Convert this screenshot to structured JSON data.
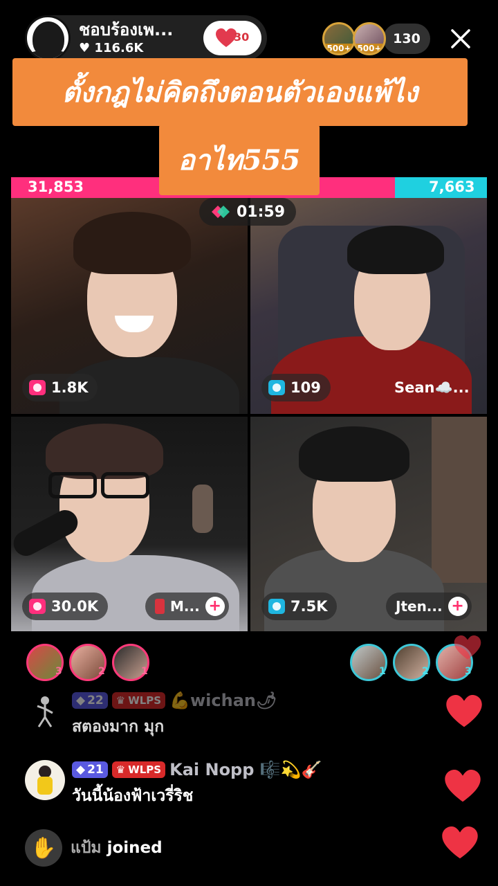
{
  "host": {
    "name": "ชอบร้องเพ...",
    "likes": "116.6K",
    "fan_level": "30"
  },
  "top_viewers": [
    {
      "badge": "500+"
    },
    {
      "badge": "500+"
    }
  ],
  "viewer_count": "130",
  "caption": {
    "line1": "ตั้งกฎไม่คิดถึงตอนตัวเองแพ้ไง",
    "line2": "อาไท555"
  },
  "battle": {
    "left_score": "31,853",
    "right_score": "7,663",
    "left_fraction": 0.806,
    "timer": "01:59"
  },
  "tiles": [
    {
      "score": "1.8K",
      "team": "pink",
      "name": ""
    },
    {
      "score": "109",
      "team": "blue",
      "name": "Sean☁️..."
    },
    {
      "score": "30.0K",
      "team": "pink",
      "name": "M..."
    },
    {
      "score": "7.5K",
      "team": "blue",
      "name": "Jten..."
    }
  ],
  "supporters_left": [
    {
      "rank": "3"
    },
    {
      "rank": "2"
    },
    {
      "rank": "1"
    }
  ],
  "supporters_right": [
    {
      "rank": "1"
    },
    {
      "rank": "2"
    },
    {
      "rank": "3"
    }
  ],
  "comments": [
    {
      "level": "22",
      "club": "WLPS",
      "username": "💪wichan🌶",
      "text": "สตองมาก มุก"
    },
    {
      "level": "21",
      "club": "WLPS",
      "username": "Kai Nopp 🎼💫🎸",
      "text": "วันนี้น้องฟ้าเวรี่ริช"
    }
  ],
  "join_notice": {
    "name": "แป้ม",
    "action": "joined"
  },
  "colors": {
    "pink": "#ff2f7d",
    "blue": "#1fd0e0",
    "caption_bg": "#f28a3c",
    "heart": "#ee3344"
  }
}
